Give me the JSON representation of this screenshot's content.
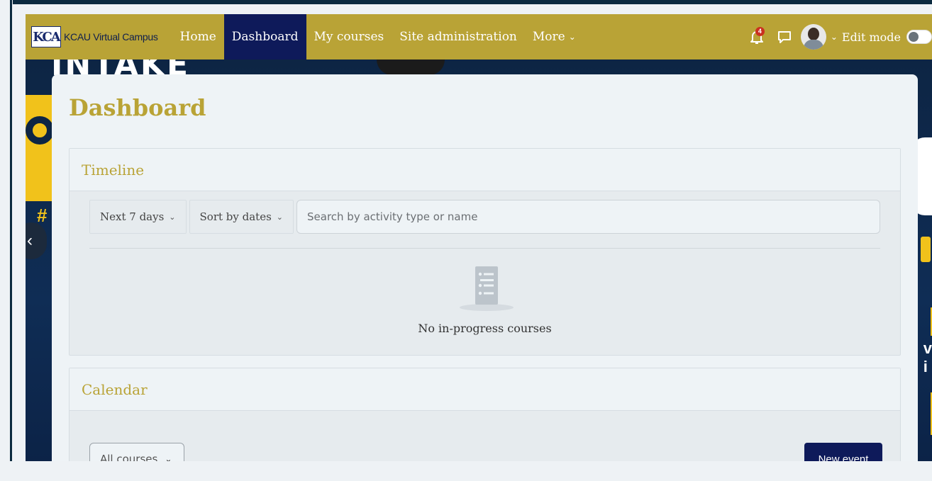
{
  "navbar": {
    "brand": "KCAU Virtual Campus",
    "logo_text": "KCA",
    "items": [
      {
        "label": "Home",
        "active": false
      },
      {
        "label": "Dashboard",
        "active": true
      },
      {
        "label": "My courses",
        "active": false
      },
      {
        "label": "Site administration",
        "active": false
      },
      {
        "label": "More",
        "active": false,
        "dropdown": true
      }
    ],
    "notification_count": "4",
    "edit_mode_label": "Edit mode",
    "edit_mode_on": false
  },
  "hero": {
    "text": "INTAKE"
  },
  "page": {
    "title": "Dashboard"
  },
  "timeline": {
    "title": "Timeline",
    "range_filter": "Next 7 days",
    "sort_filter": "Sort by dates",
    "search_placeholder": "Search by activity type or name",
    "empty_message": "No in-progress courses"
  },
  "calendar": {
    "title": "Calendar",
    "course_filter": "All courses",
    "new_event_label": "New event"
  },
  "colors": {
    "brand_gold": "#b9a336",
    "navy": "#0e1a5a",
    "badge_red": "#ca3120"
  }
}
